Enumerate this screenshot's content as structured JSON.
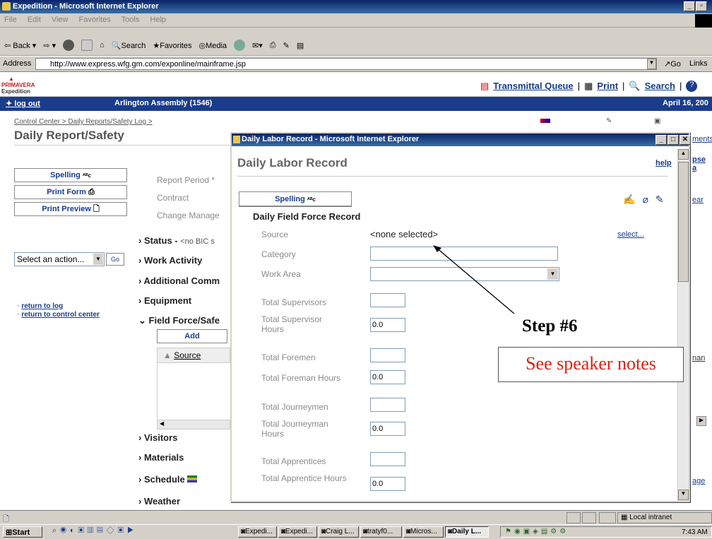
{
  "window": {
    "title": "Expedition - Microsoft Internet Explorer"
  },
  "menu": [
    "File",
    "Edit",
    "View",
    "Favorites",
    "Tools",
    "Help"
  ],
  "toolbar": {
    "back": "Back",
    "search": "Search",
    "favorites": "Favorites",
    "media": "Media"
  },
  "address": {
    "label": "Address",
    "url": "http://www.express.wfg.gm.com/exponline/mainframe.jsp",
    "go": "Go",
    "links": "Links"
  },
  "brand": {
    "name": "PRIMAVERA",
    "sub": "Expedition"
  },
  "header_links": {
    "transmittal": "Transmittal Queue",
    "print": "Print",
    "search": "Search"
  },
  "bluebar": {
    "logout": "log out",
    "project": "Arlington Assembly (1546)",
    "date": "April 16, 200"
  },
  "breadcrumb": "Control Center > Daily Reports/Safety Log >",
  "page_title": "Daily Report/Safety",
  "side_buttons": {
    "spelling": "Spelling",
    "print_form": "Print Form",
    "print_preview": "Print Preview"
  },
  "action_select": "Select an action...",
  "go_btn": "Go",
  "side_links": {
    "return_log": "return to log",
    "return_cc": "return to control center"
  },
  "form_labels": {
    "report_period": "Report Period *",
    "contract": "Contract",
    "change_manage": "Change Manage"
  },
  "sections": [
    "Status - ",
    "Work Activity",
    "Additional Comm",
    "Equipment",
    "Field Force/Safe",
    "Visitors",
    "Materials",
    "Schedule",
    "Weather"
  ],
  "status_value": "<no BIC s",
  "add_btn": "Add",
  "source_col": "Source",
  "right_edge": {
    "ments": "ments",
    "pse": "pse a",
    "ear": "ear",
    "nan": "nan",
    "age": "age"
  },
  "popup": {
    "title": "Daily Labor Record - Microsoft Internet Explorer",
    "heading": "Daily Labor Record",
    "help": "help",
    "spelling": "Spelling",
    "subheading": "Daily Field Force Record",
    "source_label": "Source",
    "source_value": "<none selected>",
    "select_link": "select...",
    "fields": [
      {
        "label": "Category",
        "value": ""
      },
      {
        "label": "Work Area",
        "value": ""
      },
      {
        "label": "Total Supervisors",
        "value": ""
      },
      {
        "label": "Total Supervisor Hours",
        "value": "0.0"
      },
      {
        "label": "Total Foremen",
        "value": ""
      },
      {
        "label": "Total Foreman Hours",
        "value": "0.0"
      },
      {
        "label": "Total Journeymen",
        "value": ""
      },
      {
        "label": "Total Journeyman Hours",
        "value": "0.0"
      },
      {
        "label": "Total Apprentices",
        "value": ""
      },
      {
        "label": "Total Apprentice Hours",
        "value": "0.0"
      }
    ]
  },
  "annotation": {
    "step": "Step #6",
    "note": "See speaker notes"
  },
  "status": {
    "zone": "Local intranet"
  },
  "taskbar": {
    "start": "Start",
    "tasks": [
      "Expedi...",
      "Expedi...",
      "Craig L...",
      "tratyf0...",
      "Micros...",
      "Daily L..."
    ],
    "clock": "7:43 AM"
  }
}
